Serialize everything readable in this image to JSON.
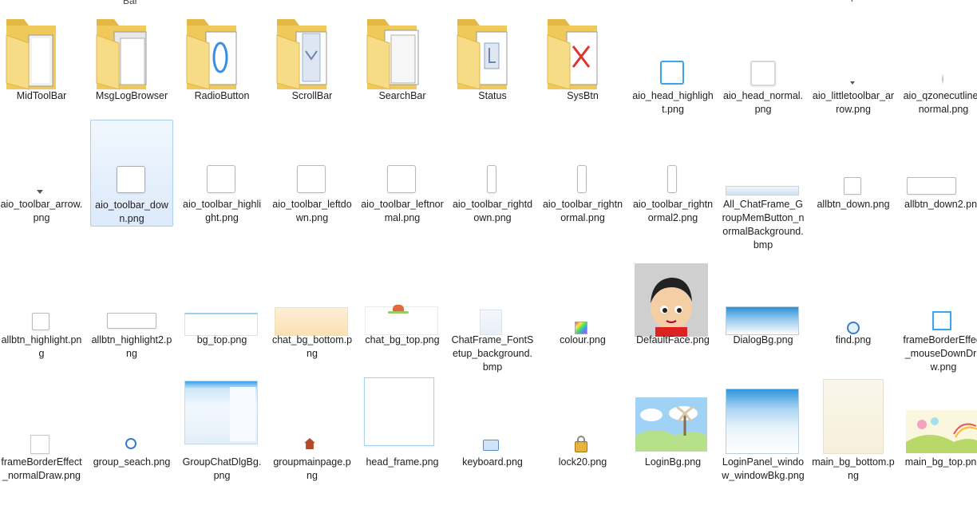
{
  "stubs": {
    "top_left": "Bar",
    "top_right": "r"
  },
  "rows": [
    [
      {
        "label": "MidToolBar",
        "kind": "folder"
      },
      {
        "label": "MsgLogBrowser",
        "kind": "folder"
      },
      {
        "label": "RadioButton",
        "kind": "folder"
      },
      {
        "label": "ScrollBar",
        "kind": "folder"
      },
      {
        "label": "SearchBar",
        "kind": "folder"
      },
      {
        "label": "Status",
        "kind": "folder"
      },
      {
        "label": "SysBtn",
        "kind": "folder"
      },
      {
        "label": "aio_head_highlight.png",
        "kind": "image"
      },
      {
        "label": "aio_head_normal.png",
        "kind": "image"
      },
      {
        "label": "aio_littletoolbar_arrow.png",
        "kind": "image"
      },
      {
        "label": "aio_qzonecutline_normal.png",
        "kind": "image"
      }
    ],
    [
      {
        "label": "aio_toolbar_arrow.png",
        "kind": "image"
      },
      {
        "label": "aio_toolbar_down.png",
        "kind": "image",
        "selected": true
      },
      {
        "label": "aio_toolbar_highlight.png",
        "kind": "image"
      },
      {
        "label": "aio_toolbar_leftdown.png",
        "kind": "image"
      },
      {
        "label": "aio_toolbar_leftnormal.png",
        "kind": "image"
      },
      {
        "label": "aio_toolbar_rightdown.png",
        "kind": "image"
      },
      {
        "label": "aio_toolbar_rightnormal.png",
        "kind": "image"
      },
      {
        "label": "aio_toolbar_rightnormal2.png",
        "kind": "image"
      },
      {
        "label": "All_ChatFrame_GroupMemButton_normalBackground.bmp",
        "kind": "image"
      },
      {
        "label": "allbtn_down.png",
        "kind": "image"
      },
      {
        "label": "allbtn_down2.png",
        "kind": "image"
      }
    ],
    [
      {
        "label": "allbtn_highlight.png",
        "kind": "image"
      },
      {
        "label": "allbtn_highlight2.png",
        "kind": "image"
      },
      {
        "label": "bg_top.png",
        "kind": "image"
      },
      {
        "label": "chat_bg_bottom.png",
        "kind": "image"
      },
      {
        "label": "chat_bg_top.png",
        "kind": "image"
      },
      {
        "label": "ChatFrame_FontSetup_background.bmp",
        "kind": "image"
      },
      {
        "label": "colour.png",
        "kind": "image"
      },
      {
        "label": "DefaultFace.png",
        "kind": "image"
      },
      {
        "label": "DialogBg.png",
        "kind": "image"
      },
      {
        "label": "find.png",
        "kind": "image"
      },
      {
        "label": "frameBorderEffect_mouseDownDraw.png",
        "kind": "image"
      }
    ],
    [
      {
        "label": "frameBorderEffect_normalDraw.png",
        "kind": "image"
      },
      {
        "label": "group_seach.png",
        "kind": "image"
      },
      {
        "label": "GroupChatDlgBg.png",
        "kind": "image"
      },
      {
        "label": "groupmainpage.png",
        "kind": "image"
      },
      {
        "label": "head_frame.png",
        "kind": "image"
      },
      {
        "label": "keyboard.png",
        "kind": "image"
      },
      {
        "label": "lock20.png",
        "kind": "image"
      },
      {
        "label": "LoginBg.png",
        "kind": "image"
      },
      {
        "label": "LoginPanel_window_windowBkg.png",
        "kind": "image"
      },
      {
        "label": "main_bg_bottom.png",
        "kind": "image"
      },
      {
        "label": "main_bg_top.png",
        "kind": "image"
      }
    ]
  ],
  "colors": {
    "folder_back": "#e3b845",
    "folder_front": "#f6dc86",
    "selection_border": "#a9cdf3",
    "selection_fill": "#e6f0fc"
  }
}
